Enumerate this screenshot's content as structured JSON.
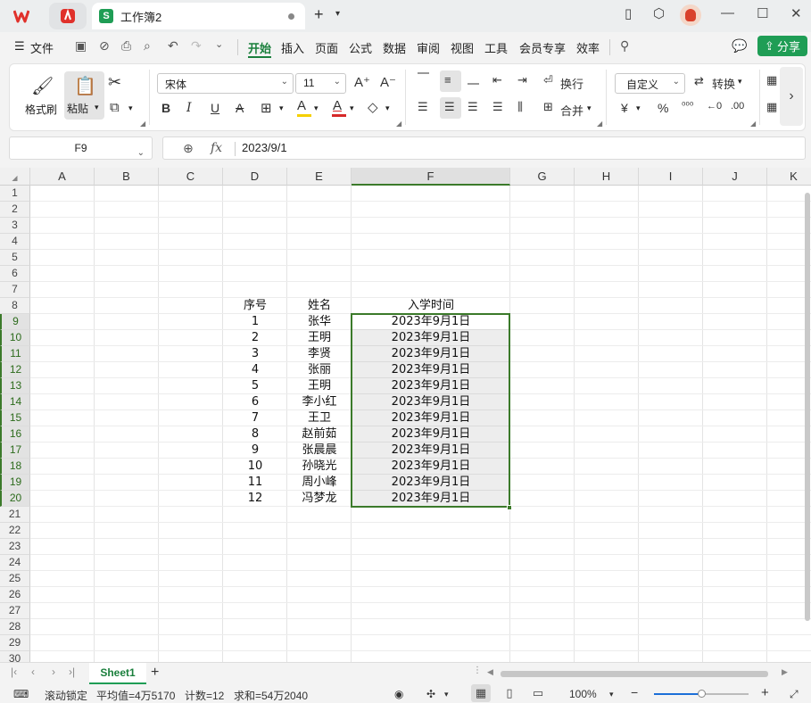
{
  "window": {
    "doc_tab_title": "工作簿2",
    "doc_icon_letter": "S",
    "new_tab": "+",
    "tab_dropdown": "⌄"
  },
  "menu": {
    "file": "文件",
    "tabs": [
      "开始",
      "插入",
      "页面",
      "公式",
      "数据",
      "审阅",
      "视图",
      "工具",
      "会员专享",
      "效率"
    ],
    "active_tab": "开始",
    "share": "分享"
  },
  "ribbon": {
    "format_painter": "格式刷",
    "paste": "粘贴",
    "font_name": "宋体",
    "font_size": "11",
    "wrap": "换行",
    "merge": "合并",
    "number_format": "自定义",
    "convert": "转换",
    "font_color": "#d62828",
    "highlight_color": "#f5d000"
  },
  "formula_bar": {
    "name_box": "F9",
    "fx": "fx",
    "value": "2023/9/1"
  },
  "columns": [
    "A",
    "B",
    "C",
    "D",
    "E",
    "F",
    "G",
    "H",
    "I",
    "J",
    "K"
  ],
  "selected_column": "F",
  "row_numbers": [
    "1",
    "2",
    "3",
    "4",
    "5",
    "6",
    "7",
    "8",
    "9",
    "10",
    "11",
    "12",
    "13",
    "14",
    "15",
    "16",
    "17",
    "18",
    "19",
    "20",
    "21",
    "22",
    "23",
    "24",
    "25",
    "26",
    "27",
    "28",
    "29",
    "30"
  ],
  "selected_rows": [
    "9",
    "10",
    "11",
    "12",
    "13",
    "14",
    "15",
    "16",
    "17",
    "18",
    "19",
    "20"
  ],
  "table": {
    "header": {
      "seq": "序号",
      "name": "姓名",
      "date": "入学时间"
    },
    "rows": [
      {
        "seq": "1",
        "name": "张华",
        "date": "2023年9月1日"
      },
      {
        "seq": "2",
        "name": "王明",
        "date": "2023年9月1日"
      },
      {
        "seq": "3",
        "name": "李贤",
        "date": "2023年9月1日"
      },
      {
        "seq": "4",
        "name": "张丽",
        "date": "2023年9月1日"
      },
      {
        "seq": "5",
        "name": "王明",
        "date": "2023年9月1日"
      },
      {
        "seq": "6",
        "name": "李小红",
        "date": "2023年9月1日"
      },
      {
        "seq": "7",
        "name": "王卫",
        "date": "2023年9月1日"
      },
      {
        "seq": "8",
        "name": "赵前茹",
        "date": "2023年9月1日"
      },
      {
        "seq": "9",
        "name": "张晨晨",
        "date": "2023年9月1日"
      },
      {
        "seq": "10",
        "name": "孙晓光",
        "date": "2023年9月1日"
      },
      {
        "seq": "11",
        "name": "周小峰",
        "date": "2023年9月1日"
      },
      {
        "seq": "12",
        "name": "冯梦龙",
        "date": "2023年9月1日"
      }
    ]
  },
  "sheets": {
    "active": "Sheet1",
    "add": "+"
  },
  "status": {
    "scroll_lock": "滚动锁定",
    "average": "平均值=4万5170",
    "count": "计数=12",
    "sum": "求和=54万2040",
    "zoom": "100%",
    "zoom_fraction": 0.5
  },
  "accent_color": "#1f9d55",
  "selection_color": "#3b7a2a"
}
